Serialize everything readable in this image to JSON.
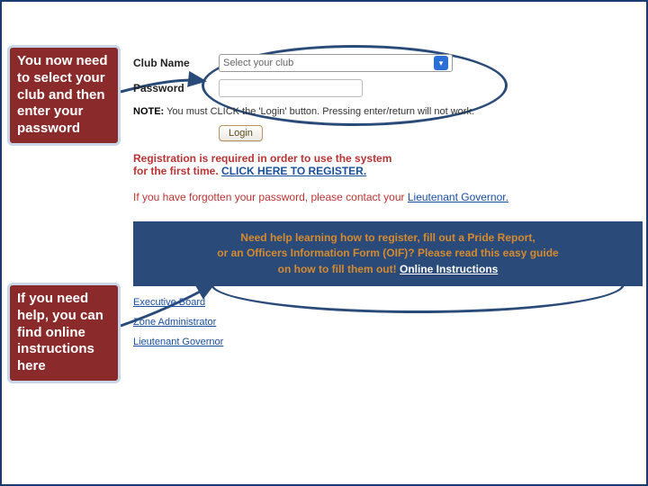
{
  "callouts": {
    "top": "You now need to select your club and then enter your password",
    "bottom": "If you need help, you can find online instructions here"
  },
  "form": {
    "club_label": "Club Name",
    "club_placeholder": "Select your club",
    "password_label": "Password",
    "note_prefix": "NOTE:",
    "note_text": "You must CLICK the 'Login' button. Pressing enter/return will not work.",
    "login_label": "Login"
  },
  "registration": {
    "line1": "Registration is required in order to use the system",
    "line2_prefix": "for the first time.",
    "link_text": "CLICK HERE TO REGISTER."
  },
  "forgot": {
    "text_prefix": "If you have forgotten your password, please contact your",
    "link_text": "Lieutenant Governor."
  },
  "help_banner": {
    "line1": "Need help learning how to register, fill out a Pride Report,",
    "line2": "or an Officers Information Form (OIF)? Please read this easy guide",
    "line3_prefix": "on how to fill them out!",
    "link_text": "Online Instructions"
  },
  "roles": {
    "exec": "Executive Board",
    "zone": "Zone Administrator",
    "ltg": "Lieutenant Governor"
  }
}
